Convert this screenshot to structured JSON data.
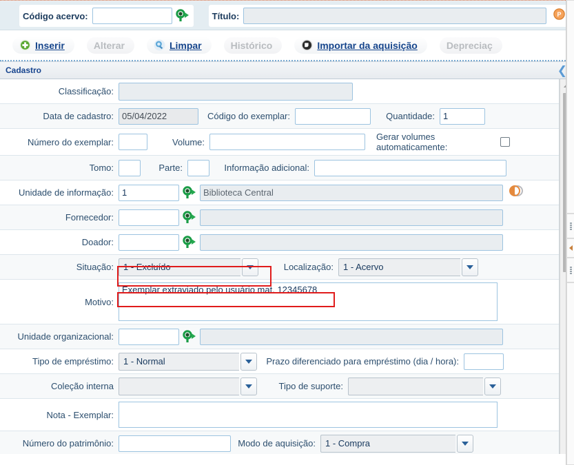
{
  "search": {
    "codigo_label": "Código acervo:",
    "codigo_value": "",
    "titulo_label": "Título:",
    "titulo_value": "",
    "search_icon": "magnifier-green-icon",
    "p_icon": "pergamum-p-icon",
    "w_icon": "worldcat-w-icon"
  },
  "toolbar": {
    "buttons": [
      {
        "label": "Inserir",
        "icon": "plus-circle-green-icon",
        "enabled": true
      },
      {
        "label": "Alterar",
        "icon": "none",
        "enabled": false
      },
      {
        "label": "Limpar",
        "icon": "eraser-blue-icon",
        "enabled": true
      },
      {
        "label": "Histórico",
        "icon": "none",
        "enabled": false
      },
      {
        "label": "Importar da aquisição",
        "icon": "import-dark-icon",
        "enabled": true
      },
      {
        "label": "Depreciaç",
        "icon": "none",
        "enabled": false
      }
    ]
  },
  "section": {
    "title": "Cadastro",
    "collapse_icon": "chevron-left-icon"
  },
  "form": {
    "classificacao": {
      "label": "Classificação:",
      "value": ""
    },
    "data_cadastro": {
      "label": "Data de cadastro:",
      "value": "05/04/2022"
    },
    "codigo_exemplar": {
      "label": "Código do exemplar:",
      "value": ""
    },
    "quantidade": {
      "label": "Quantidade:",
      "value": "1"
    },
    "numero_exemplar": {
      "label": "Número do exemplar:",
      "value": ""
    },
    "volume": {
      "label": "Volume:",
      "value": ""
    },
    "gerar_volumes": {
      "label": "Gerar volumes automaticamente:",
      "checked": false
    },
    "tomo": {
      "label": "Tomo:",
      "value": ""
    },
    "parte": {
      "label": "Parte:",
      "value": ""
    },
    "info_adicional": {
      "label": "Informação adicional:",
      "value": ""
    },
    "unidade_informacao": {
      "label": "Unidade de informação:",
      "code": "1",
      "name": "Biblioteca Central",
      "trailing_icon": "copy-orange-icon"
    },
    "fornecedor": {
      "label": "Fornecedor:",
      "code": "",
      "name": ""
    },
    "doador": {
      "label": "Doador:",
      "code": "",
      "name": ""
    },
    "situacao": {
      "label": "Situação:",
      "value": "1 - Excluído",
      "highlighted": true
    },
    "localizacao": {
      "label": "Localização:",
      "value": "1 - Acervo"
    },
    "motivo": {
      "label": "Motivo:",
      "value": "Exemplar extraviado pelo usuário mat. 12345678",
      "highlighted": true
    },
    "unidade_organizacional": {
      "label": "Unidade organizacional:",
      "code": "",
      "name": ""
    },
    "tipo_emprestimo": {
      "label": "Tipo de empréstimo:",
      "value": "1 - Normal"
    },
    "prazo_diferenciado": {
      "label": "Prazo diferenciado para empréstimo (dia / hora):",
      "value": ""
    },
    "colecao_interna": {
      "label": "Coleção interna",
      "value": ""
    },
    "tipo_suporte": {
      "label": "Tipo de suporte:",
      "value": ""
    },
    "nota_exemplar": {
      "label": "Nota - Exemplar:",
      "value": ""
    },
    "numero_patrimonio": {
      "label": "Número do patrimônio:",
      "value": ""
    },
    "modo_aquisicao": {
      "label": "Modo de aquisição:",
      "value": "1 - Compra"
    }
  },
  "scrollbar": {
    "up_icon": "scroll-up-arrow-icon",
    "thumb": "scroll-thumb"
  },
  "splitter": {
    "collapse_icon": "splitter-collapse-arrow-icon",
    "grip_icon": "splitter-grip-dots-icon"
  },
  "colors": {
    "accent_blue": "#16458c",
    "label_blue": "#2c4e6e",
    "highlight_red": "#e01b1b",
    "bar_bg": "#e4edf2"
  }
}
